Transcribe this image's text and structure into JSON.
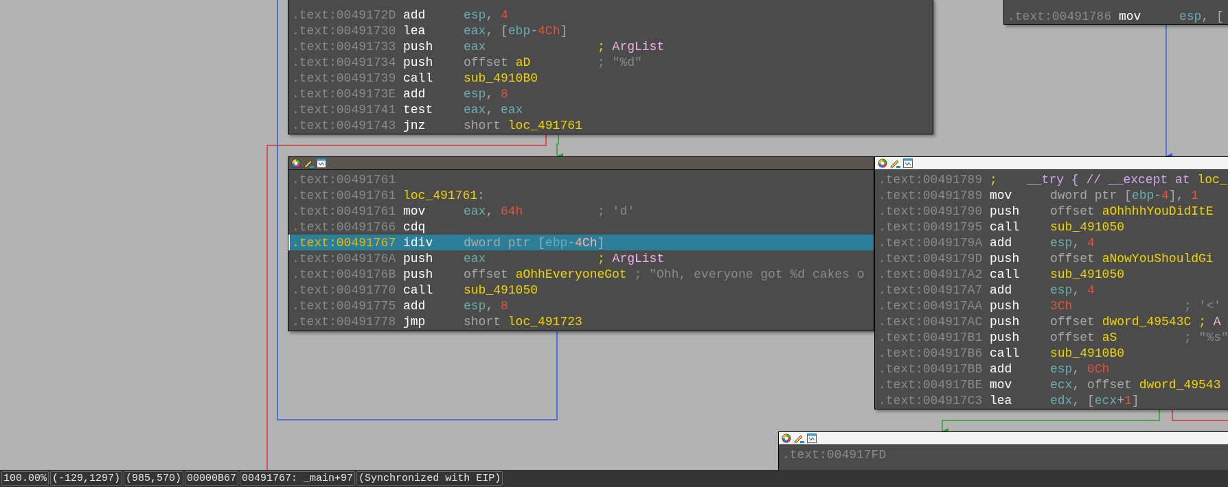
{
  "nodes": [
    {
      "rows": [
        {
          "address": ".text:0049172D",
          "mnemonic": "add",
          "operands": [
            {
              "kind": "reg",
              "text": "esp"
            },
            {
              "kind": "p",
              "text": ", "
            },
            {
              "kind": "num",
              "text": "4"
            }
          ]
        },
        {
          "address": ".text:00491730",
          "mnemonic": "lea",
          "operands": [
            {
              "kind": "reg",
              "text": "eax"
            },
            {
              "kind": "p",
              "text": ", ["
            },
            {
              "kind": "reg",
              "text": "ebp"
            },
            {
              "kind": "p",
              "text": "-"
            },
            {
              "kind": "num",
              "text": "4Ch"
            },
            {
              "kind": "p",
              "text": "]"
            }
          ]
        },
        {
          "address": ".text:00491733",
          "mnemonic": "push",
          "operands": [
            {
              "kind": "reg",
              "text": "eax"
            }
          ],
          "comment": [
            {
              "kind": "name",
              "text": ";"
            },
            {
              "kind": "pink",
              "text": " ArgList"
            }
          ]
        },
        {
          "address": ".text:00491734",
          "mnemonic": "push",
          "operands": [
            {
              "kind": "kw",
              "text": "offset "
            },
            {
              "kind": "name",
              "text": "aD"
            }
          ],
          "comment": [
            {
              "kind": "cmt",
              "text": "; \"%d\""
            }
          ]
        },
        {
          "address": ".text:00491739",
          "mnemonic": "call",
          "operands": [
            {
              "kind": "name",
              "text": "sub_4910B0"
            }
          ]
        },
        {
          "address": ".text:0049173E",
          "mnemonic": "add",
          "operands": [
            {
              "kind": "reg",
              "text": "esp"
            },
            {
              "kind": "p",
              "text": ", "
            },
            {
              "kind": "num",
              "text": "8"
            }
          ]
        },
        {
          "address": ".text:00491741",
          "mnemonic": "test",
          "operands": [
            {
              "kind": "reg",
              "text": "eax"
            },
            {
              "kind": "p",
              "text": ", "
            },
            {
              "kind": "reg",
              "text": "eax"
            }
          ]
        },
        {
          "address": ".text:00491743",
          "mnemonic": "jnz",
          "operands": [
            {
              "kind": "kw",
              "text": "short "
            },
            {
              "kind": "name",
              "text": "loc_491761"
            }
          ]
        }
      ]
    },
    {
      "rows": [
        {
          "address": ".text:00491786",
          "mnemonic": "mov",
          "operands": [
            {
              "kind": "reg",
              "text": "esp"
            },
            {
              "kind": "p",
              "text": ", ["
            }
          ]
        }
      ]
    },
    {
      "focused": false,
      "rows": [
        {
          "address": ".text:00491761",
          "selected": false
        },
        {
          "address": ".text:00491761",
          "selected": false,
          "label": [
            {
              "kind": "name",
              "text": "loc_491761"
            },
            {
              "kind": "p",
              "text": ":"
            }
          ]
        },
        {
          "address": ".text:00491761",
          "selected": false,
          "mnemonic": "mov",
          "operands": [
            {
              "kind": "reg",
              "text": "eax"
            },
            {
              "kind": "p",
              "text": ", "
            },
            {
              "kind": "num",
              "text": "64h"
            }
          ],
          "comment": [
            {
              "kind": "cmt",
              "text": "; 'd'"
            }
          ]
        },
        {
          "address": ".text:00491766",
          "selected": false,
          "mnemonic": "cdq"
        },
        {
          "address": ".text:00491767",
          "selected": true,
          "mnemonic": "idiv",
          "operands": [
            {
              "kind": "kw",
              "text": "dword ptr ["
            },
            {
              "kind": "reg",
              "text": "ebp"
            },
            {
              "kind": "p",
              "text": "-"
            },
            {
              "kind": "num",
              "text": "4Ch"
            },
            {
              "kind": "p",
              "text": "]"
            }
          ]
        },
        {
          "address": ".text:0049176A",
          "selected": false,
          "mnemonic": "push",
          "operands": [
            {
              "kind": "reg",
              "text": "eax"
            }
          ],
          "comment": [
            {
              "kind": "name",
              "text": ";"
            },
            {
              "kind": "pink",
              "text": " ArgList"
            }
          ]
        },
        {
          "address": ".text:0049176B",
          "selected": false,
          "mnemonic": "push",
          "operands": [
            {
              "kind": "kw",
              "text": "offset "
            },
            {
              "kind": "name",
              "text": "aOhhEveryoneGot"
            }
          ],
          "comment": [
            {
              "kind": "cmt",
              "text": "; \"Ohh, everyone got %d cakes o"
            }
          ]
        },
        {
          "address": ".text:00491770",
          "selected": false,
          "mnemonic": "call",
          "operands": [
            {
              "kind": "name",
              "text": "sub_491050"
            }
          ]
        },
        {
          "address": ".text:00491775",
          "selected": false,
          "mnemonic": "add",
          "operands": [
            {
              "kind": "reg",
              "text": "esp"
            },
            {
              "kind": "p",
              "text": ", "
            },
            {
              "kind": "num",
              "text": "8"
            }
          ]
        },
        {
          "address": ".text:00491778",
          "selected": false,
          "mnemonic": "jmp",
          "operands": [
            {
              "kind": "kw",
              "text": "short "
            },
            {
              "kind": "name",
              "text": "loc_491723"
            }
          ]
        }
      ]
    },
    {
      "focused": true,
      "rows": [
        {
          "address": ".text:00491789",
          "label": [
            {
              "kind": "name",
              "text": ";"
            },
            {
              "kind": "violet",
              "text": "    __try { // __except at "
            },
            {
              "kind": "name",
              "text": "loc_"
            }
          ]
        },
        {
          "address": ".text:00491789",
          "mnemonic": "mov",
          "operands": [
            {
              "kind": "kw",
              "text": "dword ptr ["
            },
            {
              "kind": "reg",
              "text": "ebp"
            },
            {
              "kind": "p",
              "text": "-"
            },
            {
              "kind": "num",
              "text": "4"
            },
            {
              "kind": "p",
              "text": "], "
            },
            {
              "kind": "num",
              "text": "1"
            }
          ]
        },
        {
          "address": ".text:00491790",
          "mnemonic": "push",
          "operands": [
            {
              "kind": "kw",
              "text": "offset "
            },
            {
              "kind": "name",
              "text": "aOhhhhYouDidItE"
            }
          ]
        },
        {
          "address": ".text:00491795",
          "mnemonic": "call",
          "operands": [
            {
              "kind": "name",
              "text": "sub_491050"
            }
          ]
        },
        {
          "address": ".text:0049179A",
          "mnemonic": "add",
          "operands": [
            {
              "kind": "reg",
              "text": "esp"
            },
            {
              "kind": "p",
              "text": ", "
            },
            {
              "kind": "num",
              "text": "4"
            }
          ]
        },
        {
          "address": ".text:0049179D",
          "mnemonic": "push",
          "operands": [
            {
              "kind": "kw",
              "text": "offset "
            },
            {
              "kind": "name",
              "text": "aNowYouShouldGi"
            }
          ]
        },
        {
          "address": ".text:004917A2",
          "mnemonic": "call",
          "operands": [
            {
              "kind": "name",
              "text": "sub_491050"
            }
          ]
        },
        {
          "address": ".text:004917A7",
          "mnemonic": "add",
          "operands": [
            {
              "kind": "reg",
              "text": "esp"
            },
            {
              "kind": "p",
              "text": ", "
            },
            {
              "kind": "num",
              "text": "4"
            }
          ]
        },
        {
          "address": ".text:004917AA",
          "mnemonic": "push",
          "operands": [
            {
              "kind": "num",
              "text": "3Ch"
            }
          ],
          "comment": [
            {
              "kind": "cmt",
              "text": "; '<'"
            }
          ]
        },
        {
          "address": ".text:004917AC",
          "mnemonic": "push",
          "operands": [
            {
              "kind": "kw",
              "text": "offset "
            },
            {
              "kind": "name",
              "text": "dword_49543C"
            }
          ],
          "comment": [
            {
              "kind": "name",
              "text": ";"
            },
            {
              "kind": "pink",
              "text": " A"
            }
          ]
        },
        {
          "address": ".text:004917B1",
          "mnemonic": "push",
          "operands": [
            {
              "kind": "kw",
              "text": "offset "
            },
            {
              "kind": "name",
              "text": "aS"
            }
          ],
          "comment": [
            {
              "kind": "cmt",
              "text": "; \"%s\""
            }
          ]
        },
        {
          "address": ".text:004917B6",
          "mnemonic": "call",
          "operands": [
            {
              "kind": "name",
              "text": "sub_4910B0"
            }
          ]
        },
        {
          "address": ".text:004917BB",
          "mnemonic": "add",
          "operands": [
            {
              "kind": "reg",
              "text": "esp"
            },
            {
              "kind": "p",
              "text": ", "
            },
            {
              "kind": "num",
              "text": "0Ch"
            }
          ]
        },
        {
          "address": ".text:004917BE",
          "mnemonic": "mov",
          "operands": [
            {
              "kind": "reg",
              "text": "ecx"
            },
            {
              "kind": "p",
              "text": ", "
            },
            {
              "kind": "kw",
              "text": "offset "
            },
            {
              "kind": "name",
              "text": "dword_49543"
            }
          ]
        },
        {
          "address": ".text:004917C3",
          "mnemonic": "lea",
          "operands": [
            {
              "kind": "reg",
              "text": "edx"
            },
            {
              "kind": "p",
              "text": ", ["
            },
            {
              "kind": "reg",
              "text": "ecx"
            },
            {
              "kind": "p",
              "text": "+"
            },
            {
              "kind": "num",
              "text": "1"
            },
            {
              "kind": "p",
              "text": "]"
            }
          ]
        }
      ]
    },
    {
      "focused": true,
      "rows": [
        {
          "address": ".text:004917FD"
        }
      ]
    }
  ],
  "status_bar": [
    "100.00%",
    "(-129,1297)",
    "(985,570)",
    "00000B67",
    "00491767: _main+97",
    "(Synchronized with EIP)"
  ]
}
